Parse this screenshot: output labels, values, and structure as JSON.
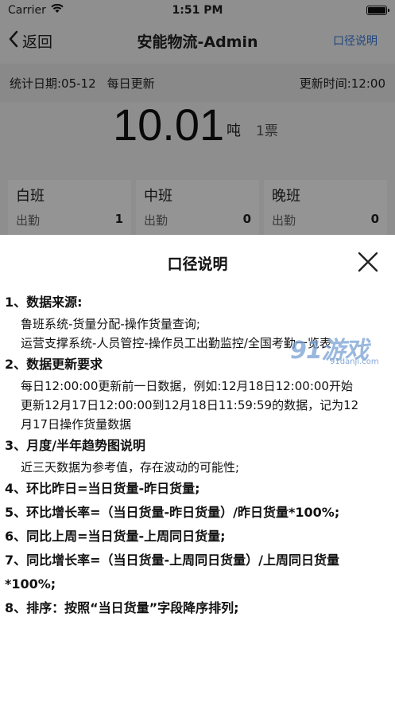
{
  "status_bar": {
    "carrier": "Carrier",
    "time": "1:51 PM"
  },
  "nav": {
    "back_label": "返回",
    "title": "安能物流-Admin",
    "right_label": "口径说明"
  },
  "info": {
    "date_label": "统计日期:05-12",
    "update_freq": "每日更新",
    "update_time": "更新时间:12:00"
  },
  "summary": {
    "tons": "10.01",
    "unit": "吨",
    "tickets": "1票"
  },
  "shifts": [
    {
      "name": "白班",
      "label": "出勤",
      "value": "1"
    },
    {
      "name": "中班",
      "label": "出勤",
      "value": "0"
    },
    {
      "name": "晚班",
      "label": "出勤",
      "value": "0"
    }
  ],
  "modal": {
    "title": "口径说明",
    "sections": [
      {
        "title": "1、数据来源:",
        "lines": [
          "鲁班系统-货量分配-操作货量查询;",
          "运营支撑系统-人员管控-操作员工出勤监控/全国考勤一览表"
        ]
      },
      {
        "title": "2、数据更新要求",
        "lines": [
          "每日12:00:00更新前一日数据，例如:12月18日12:00:00开始",
          "更新12月17日12:00:00到12月18日11:59:59的数据，记为12",
          "月17日操作货量数据"
        ]
      },
      {
        "title": "3、月度/半年趋势图说明",
        "lines": [
          "近三天数据为参考值，存在波动的可能性;"
        ]
      },
      {
        "title": "4、环比昨日=当日货量-昨日货量;",
        "lines": []
      },
      {
        "title": "5、环比增长率=（当日货量-昨日货量）/昨日货量*100%;",
        "lines": []
      },
      {
        "title": "6、同比上周=当日货量-上周同日货量;",
        "lines": []
      },
      {
        "title": "7、同比增长率=（当日货量-上周同日货量）/上周同日货量",
        "lines": []
      },
      {
        "title": "*100%;",
        "lines": []
      },
      {
        "title": "8、排序：按照“当日货量”字段降序排列;",
        "lines": []
      }
    ]
  },
  "watermark": {
    "logo": "91游戏",
    "url": "91danji.com"
  },
  "colors": {
    "accent": "#3a7ad9",
    "overlay": "rgba(0,0,0,0.42)"
  }
}
